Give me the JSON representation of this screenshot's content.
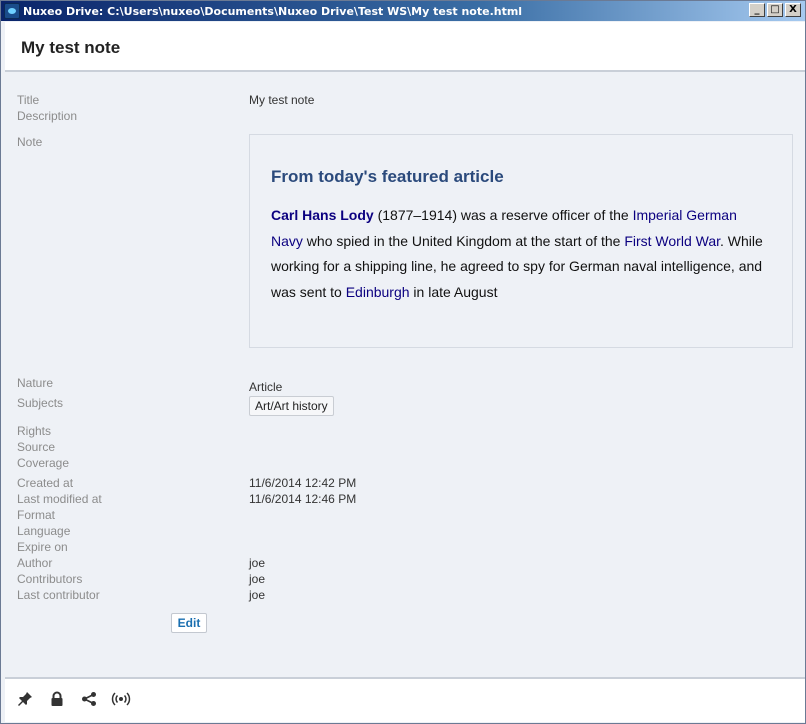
{
  "window": {
    "title": "Nuxeo Drive: C:\\Users\\nuxeo\\Documents\\Nuxeo Drive\\Test WS\\My test note.html",
    "buttons": {
      "minimize": "_",
      "maximize": "□",
      "close": "X"
    }
  },
  "header": {
    "title": "My test note"
  },
  "fields": {
    "title": {
      "label": "Title",
      "value": "My test note"
    },
    "description": {
      "label": "Description"
    },
    "note": {
      "label": "Note"
    },
    "nature": {
      "label": "Nature",
      "value": "Article"
    },
    "subjects": {
      "label": "Subjects",
      "value": "Art/Art history"
    },
    "rights": {
      "label": "Rights"
    },
    "source": {
      "label": "Source"
    },
    "coverage": {
      "label": "Coverage"
    },
    "created_at": {
      "label": "Created at",
      "value": "11/6/2014 12:42 PM"
    },
    "last_modified_at": {
      "label": "Last modified at",
      "value": "11/6/2014 12:46 PM"
    },
    "format": {
      "label": "Format"
    },
    "language": {
      "label": "Language"
    },
    "expire_on": {
      "label": "Expire on"
    },
    "author": {
      "label": "Author",
      "value": "joe"
    },
    "contributors": {
      "label": "Contributors",
      "value": "joe"
    },
    "last_contributor": {
      "label": "Last contributor",
      "value": "joe"
    }
  },
  "note": {
    "heading": "From today's featured article",
    "subject_link": "Carl Hans Lody",
    "text_1": " (1877–1914) was a reserve officer of the ",
    "link_1": "Imperial German Navy",
    "text_2": " who spied in the United Kingdom at the start of the ",
    "link_2": "First World War",
    "text_3": ". While working for a shipping line, he agreed to spy for German naval intelligence, and was sent to ",
    "link_3": "Edinburgh",
    "text_4": " in late August"
  },
  "actions": {
    "edit_label": "Edit"
  },
  "footer": {
    "icons": [
      "pin-icon",
      "lock-icon",
      "share-icon",
      "broadcast-icon"
    ]
  },
  "colors": {
    "accent": "#1a6fb0",
    "link": "#0b0080",
    "heading": "#2b4a7c",
    "background": "#eef1f6"
  }
}
